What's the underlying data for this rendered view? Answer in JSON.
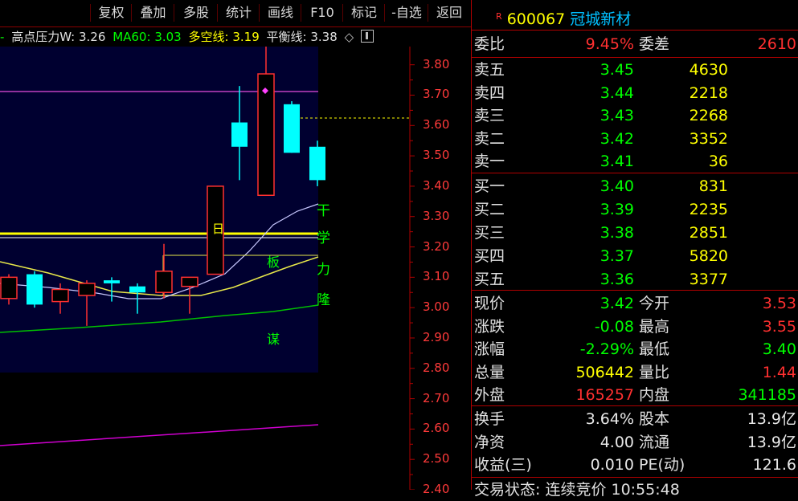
{
  "toolbar": {
    "buttons": [
      "复权",
      "叠加",
      "多股",
      "统计",
      "画线",
      "F10",
      "标记",
      "-自选",
      "返回"
    ]
  },
  "indicators": {
    "prefix": "-",
    "high_pressure_label": "高点压力W:",
    "high_pressure_value": "3.26",
    "ma60_label": "MA60:",
    "ma60_value": "3.03",
    "longshort_label": "多空线:",
    "longshort_value": "3.19",
    "balance_label": "平衡线:",
    "balance_value": "3.38",
    "diamond": "◇"
  },
  "price_axis": [
    "3.80",
    "3.70",
    "3.60",
    "3.50",
    "3.40",
    "3.30",
    "3.20",
    "3.10",
    "3.00",
    "2.90",
    "2.80",
    "2.70",
    "2.60",
    "2.50",
    "2.40"
  ],
  "chart_texts": {
    "day_marker": "日",
    "vertical_chars": [
      "干",
      "学",
      "力",
      "隆"
    ],
    "board_char": "板",
    "plan_char": "谋"
  },
  "chart_data": {
    "type": "candlestick",
    "ylim": [
      2.4,
      3.86
    ],
    "candles": [
      {
        "open": 3.03,
        "close": 3.1,
        "high": 3.11,
        "low": 3.01
      },
      {
        "open": 3.11,
        "close": 3.01,
        "high": 3.12,
        "low": 3.0
      },
      {
        "open": 3.02,
        "close": 3.06,
        "high": 3.08,
        "low": 2.98
      },
      {
        "open": 3.04,
        "close": 3.08,
        "high": 3.09,
        "low": 2.94
      },
      {
        "open": 3.09,
        "close": 3.08,
        "high": 3.1,
        "low": 3.02
      },
      {
        "open": 3.07,
        "close": 3.05,
        "high": 3.08,
        "low": 2.98
      },
      {
        "open": 3.05,
        "close": 3.12,
        "high": 3.21,
        "low": 3.03
      },
      {
        "open": 3.07,
        "close": 3.1,
        "high": 3.1,
        "low": 2.98
      },
      {
        "open": 3.11,
        "close": 3.4,
        "high": 3.4,
        "low": 3.11
      },
      {
        "open": 3.61,
        "close": 3.53,
        "high": 3.73,
        "low": 3.42
      },
      {
        "open": 3.37,
        "close": 3.77,
        "high": 3.86,
        "low": 3.37
      },
      {
        "open": 3.67,
        "close": 3.51,
        "high": 3.68,
        "low": 3.51
      },
      {
        "open": 3.53,
        "close": 3.42,
        "high": 3.55,
        "low": 3.4
      }
    ]
  },
  "quote": {
    "code": "600067",
    "name": "冠城新材",
    "tag": "R",
    "weibi_label": "委比",
    "weibi": "9.45%",
    "weicha_label": "委差",
    "weicha": "2610",
    "sells": [
      {
        "label": "卖五",
        "price": "3.45",
        "vol": "4630"
      },
      {
        "label": "卖四",
        "price": "3.44",
        "vol": "2218"
      },
      {
        "label": "卖三",
        "price": "3.43",
        "vol": "2268"
      },
      {
        "label": "卖二",
        "price": "3.42",
        "vol": "3352"
      },
      {
        "label": "卖一",
        "price": "3.41",
        "vol": "36"
      }
    ],
    "buys": [
      {
        "label": "买一",
        "price": "3.40",
        "vol": "831"
      },
      {
        "label": "买二",
        "price": "3.39",
        "vol": "2235"
      },
      {
        "label": "买三",
        "price": "3.38",
        "vol": "2851"
      },
      {
        "label": "买四",
        "price": "3.37",
        "vol": "5820"
      },
      {
        "label": "买五",
        "price": "3.36",
        "vol": "3377"
      }
    ],
    "stats": [
      {
        "l1": "现价",
        "v1": "3.42",
        "c1": "green",
        "l2": "今开",
        "v2": "3.53",
        "c2": "red"
      },
      {
        "l1": "涨跌",
        "v1": "-0.08",
        "c1": "green",
        "l2": "最高",
        "v2": "3.55",
        "c2": "red"
      },
      {
        "l1": "涨幅",
        "v1": "-2.29%",
        "c1": "green",
        "l2": "最低",
        "v2": "3.40",
        "c2": "green"
      },
      {
        "l1": "总量",
        "v1": "506442",
        "c1": "yellow",
        "l2": "量比",
        "v2": "1.44",
        "c2": "red"
      },
      {
        "l1": "外盘",
        "v1": "165257",
        "c1": "red",
        "l2": "内盘",
        "v2": "341185",
        "c2": "green"
      }
    ],
    "fund": [
      {
        "l1": "换手",
        "v1": "3.64%",
        "l2": "股本",
        "v2": "13.9亿"
      },
      {
        "l1": "净资",
        "v1": "4.00",
        "l2": "流通",
        "v2": "13.9亿"
      },
      {
        "l1": "收益(三)",
        "v1": "0.010",
        "l2": "PE(动)",
        "v2": "121.6"
      }
    ],
    "footer": "交易状态: 连续竞价  10:55:48"
  }
}
